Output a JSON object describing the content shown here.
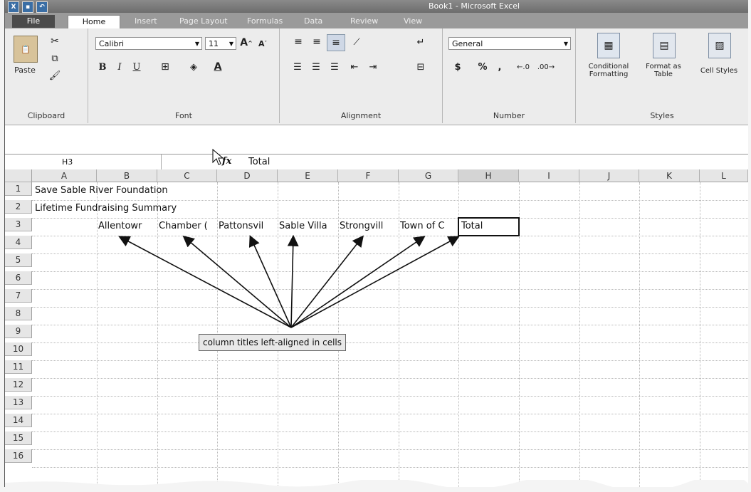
{
  "window": {
    "title": "Book1 - Microsoft Excel"
  },
  "tabs": [
    {
      "label": "File"
    },
    {
      "label": "Home"
    },
    {
      "label": "Insert"
    },
    {
      "label": "Page Layout"
    },
    {
      "label": "Formulas"
    },
    {
      "label": "Data"
    },
    {
      "label": "Review"
    },
    {
      "label": "View"
    }
  ],
  "ribbon": {
    "clipboard": {
      "paste": "Paste",
      "group": "Clipboard"
    },
    "font": {
      "name": "Calibri",
      "size": "11",
      "bold": "B",
      "italic": "I",
      "underline": "U",
      "group": "Font"
    },
    "alignment": {
      "group": "Alignment"
    },
    "number": {
      "format": "General",
      "currency": "$",
      "percent": "%",
      "comma": ",",
      "group": "Number"
    },
    "styles": {
      "conditional": "Conditional Formatting",
      "format_table": "Format as Table",
      "cell_styles": "Cell Styles",
      "group": "Styles"
    }
  },
  "formula_bar": {
    "name_box": "H3",
    "fx": "fx",
    "content": "Total"
  },
  "columns": [
    "A",
    "B",
    "C",
    "D",
    "E",
    "F",
    "G",
    "H",
    "I",
    "J",
    "K",
    "L"
  ],
  "rows": [
    "1",
    "2",
    "3",
    "4",
    "5",
    "6",
    "7",
    "8",
    "9",
    "10",
    "11",
    "12",
    "13",
    "14",
    "15",
    "16"
  ],
  "cells": {
    "A1": "Save Sable River Foundation",
    "A2": "Lifetime Fundraising Summary",
    "B3": "Allentowr",
    "C3": "Chamber (",
    "D3": "Pattonsvil",
    "E3": "Sable Villa",
    "F3": "Strongvill",
    "G3": "Town of C",
    "H3": "Total"
  },
  "callout": "column titles left-aligned in cells",
  "colors": {
    "selection_border": "#111111",
    "callout_bg": "#e8e8e8"
  }
}
